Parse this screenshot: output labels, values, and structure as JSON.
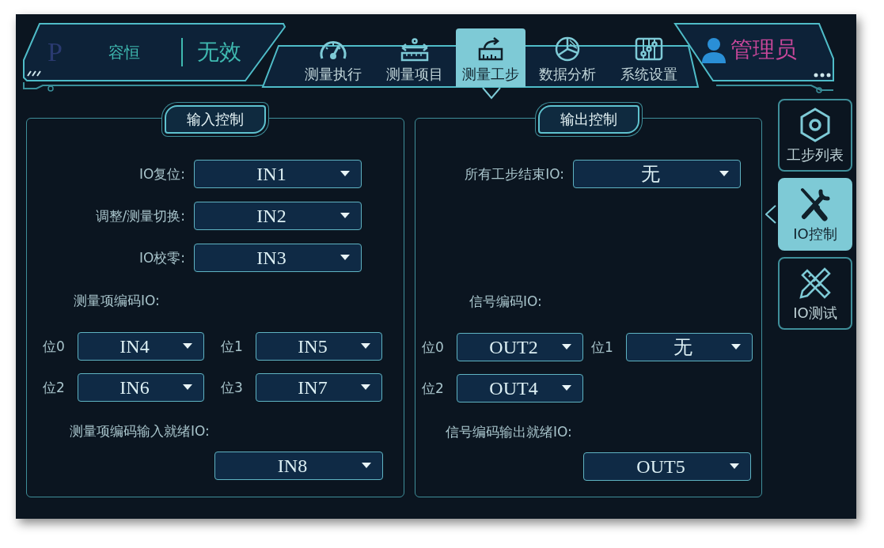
{
  "header": {
    "logo": "P",
    "name": "容恒",
    "status": "无效",
    "user": "管理员"
  },
  "nav": [
    {
      "label": "测量执行",
      "selected": false
    },
    {
      "label": "测量项目",
      "selected": false
    },
    {
      "label": "测量工步",
      "selected": true
    },
    {
      "label": "数据分析",
      "selected": false
    },
    {
      "label": "系统设置",
      "selected": false
    }
  ],
  "panels": [
    {
      "title": "输入控制",
      "rows": [
        {
          "label": "IO复位:",
          "value": "IN1"
        },
        {
          "label": "调整/测量切换:",
          "value": "IN2"
        },
        {
          "label": "IO校零:",
          "value": "IN3"
        }
      ],
      "encode": {
        "label": "测量项编码IO:",
        "bits": [
          {
            "label": "位0",
            "value": "IN4"
          },
          {
            "label": "位1",
            "value": "IN5"
          },
          {
            "label": "位2",
            "value": "IN6"
          },
          {
            "label": "位3",
            "value": "IN7"
          }
        ]
      },
      "ready": {
        "label": "测量项编码输入就绪IO:",
        "value": "IN8"
      }
    },
    {
      "title": "输出控制",
      "rows": [
        {
          "label": "所有工步结束IO:",
          "value": "无"
        }
      ],
      "encode": {
        "label": "信号编码IO:",
        "bits": [
          {
            "label": "位0",
            "value": "OUT2"
          },
          {
            "label": "位1",
            "value": "无"
          },
          {
            "label": "位2",
            "value": "OUT4"
          }
        ]
      },
      "ready": {
        "label": "信号编码输出就绪IO:",
        "value": "OUT5"
      }
    }
  ],
  "side": [
    {
      "label": "工步列表",
      "selected": false
    },
    {
      "label": "IO控制",
      "selected": true
    },
    {
      "label": "IO测试",
      "selected": false
    }
  ]
}
